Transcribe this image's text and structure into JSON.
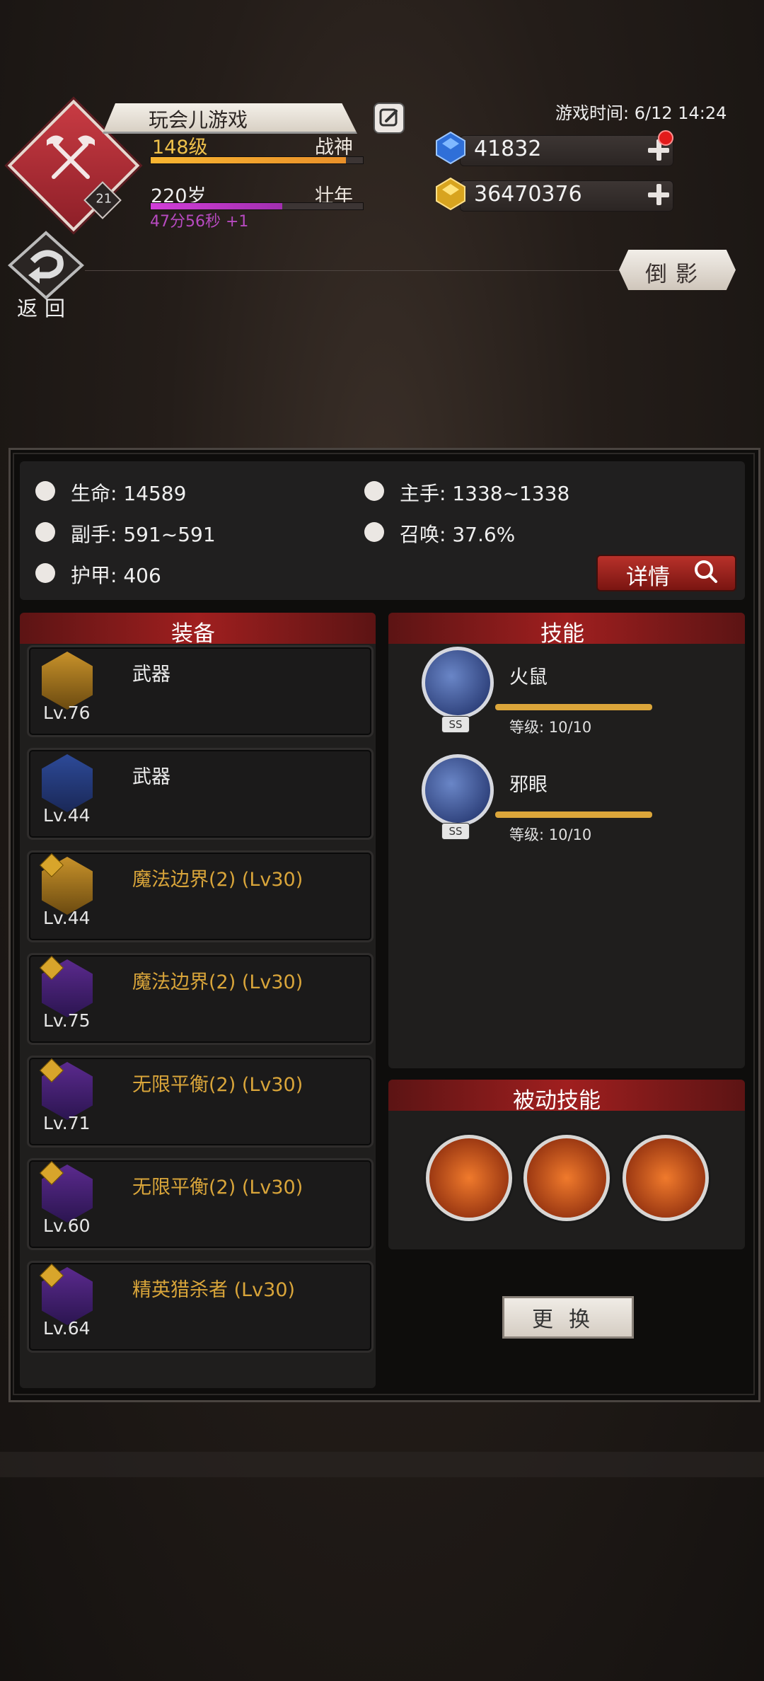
{
  "header": {
    "player_name": "玩会儿游戏",
    "level_text": "148级",
    "level_title": "战神",
    "level_progress": 0.92,
    "age_text": "220岁",
    "age_title": "壮年",
    "age_progress": 0.62,
    "age_timer": "47分56秒 +1",
    "emblem_badge": "21",
    "game_time": "游戏时间: 6/12 14:24",
    "diamonds": "41832",
    "gold": "36470376",
    "back_label": "返回",
    "reflection_button": "倒影",
    "icons": {
      "emblem": "crossed-axes-icon",
      "edit": "edit-icon",
      "diamond": "blue-gem-icon",
      "gold": "gold-gem-icon"
    }
  },
  "stats": {
    "life": "生命: 14589",
    "main_hand": "主手: 1338~1338",
    "off_hand": "副手: 591~591",
    "summon": "召唤: 37.6%",
    "armor": "护甲: 406",
    "detail_button": "详情"
  },
  "equipment": {
    "title": "装备",
    "items": [
      {
        "name": "武器",
        "level": "Lv.76",
        "rarity": "common"
      },
      {
        "name": "武器",
        "level": "Lv.44",
        "rarity": "common"
      },
      {
        "name": "魔法边界(2) (Lv30)",
        "level": "Lv.44",
        "rarity": "set"
      },
      {
        "name": "魔法边界(2) (Lv30)",
        "level": "Lv.75",
        "rarity": "set"
      },
      {
        "name": "无限平衡(2) (Lv30)",
        "level": "Lv.71",
        "rarity": "set"
      },
      {
        "name": "无限平衡(2) (Lv30)",
        "level": "Lv.60",
        "rarity": "set"
      },
      {
        "name": "精英猎杀者 (Lv30)",
        "level": "Lv.64",
        "rarity": "set"
      }
    ]
  },
  "skills": {
    "title": "技能",
    "items": [
      {
        "name": "火鼠",
        "grade": "SS",
        "level": "等级: 10/10",
        "progress": 1.0
      },
      {
        "name": "邪眼",
        "grade": "SS",
        "level": "等级: 10/10",
        "progress": 1.0
      }
    ]
  },
  "passive": {
    "title": "被动技能",
    "icons": [
      "shield-fist-icon",
      "flame-warrior-icon",
      "hourglass-icon"
    ]
  },
  "swap_button": "更换",
  "colors": {
    "accent_red": "#a01f1f",
    "gold_text": "#d9a53a",
    "level_bar": "#f0a52a",
    "age_bar": "#b23bbf"
  }
}
